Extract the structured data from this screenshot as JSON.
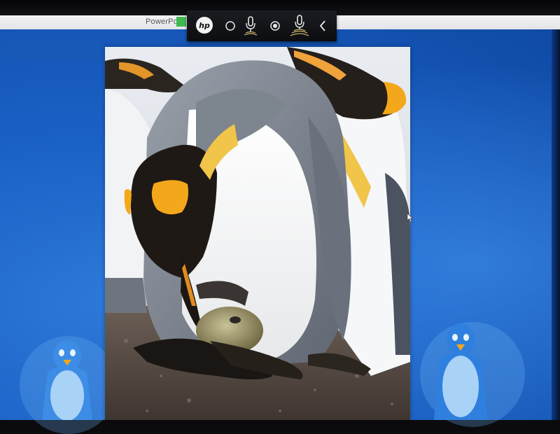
{
  "window": {
    "app_title": "PowerPo"
  },
  "toolbar": {
    "logo_text": "hp",
    "items": [
      {
        "icon": "hp-logo-icon"
      },
      {
        "icon": "record-circle-icon"
      },
      {
        "icon": "microphone-icon"
      },
      {
        "icon": "record-dot-icon"
      },
      {
        "icon": "microphone-active-icon"
      },
      {
        "icon": "chevron-left-icon"
      }
    ]
  },
  "slide": {
    "image": "king-penguin-with-egg-photo",
    "background_color": "#1a60c4",
    "mascot_icon": "penguin-mascot-icon"
  },
  "colors": {
    "slide_blue": "#1a60c4",
    "penguin_orange": "#f3a81b",
    "toolbar_bg": "#111215"
  }
}
